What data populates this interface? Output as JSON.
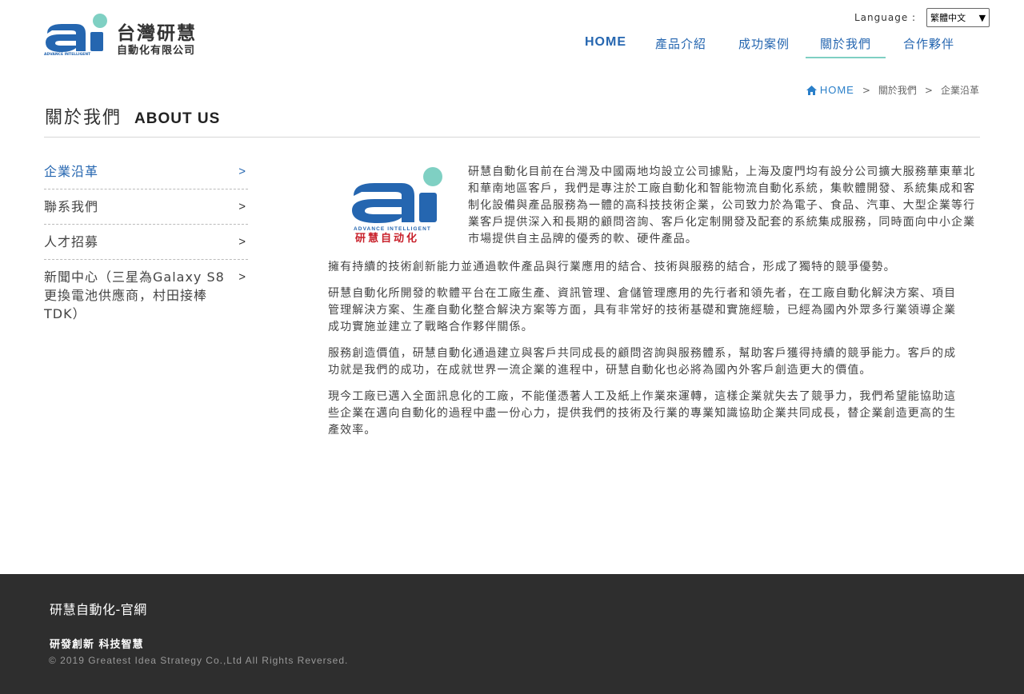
{
  "brand": {
    "logo_text": "ai",
    "logo_sub": "ADVANCE INTELLIGENT",
    "name_top": "台灣研慧",
    "name_bottom": "自動化有限公司",
    "colors": {
      "blue": "#2566b0",
      "teal": "#7fd0c3",
      "red": "#c8202a"
    }
  },
  "language": {
    "label": "Language :",
    "selected": "繁體中文",
    "arrow": "▼"
  },
  "nav": [
    {
      "label": "HOME",
      "active": false
    },
    {
      "label": "產品介紹",
      "active": false
    },
    {
      "label": "成功案例",
      "active": false
    },
    {
      "label": "關於我們",
      "active": true
    },
    {
      "label": "合作夥伴",
      "active": false
    }
  ],
  "breadcrumb": {
    "home": "HOME",
    "sep": ">",
    "level1": "關於我們",
    "level2": "企業沿革"
  },
  "page": {
    "title_cn": "關於我們",
    "title_en": "ABOUT US"
  },
  "sidebar": [
    {
      "label": "企業沿革",
      "active": true
    },
    {
      "label": "聯系我們",
      "active": false
    },
    {
      "label": "人才招募",
      "active": false
    },
    {
      "label": "新聞中心（三星為Galaxy S8更換電池供應商，村田接棒TDK）",
      "active": false
    }
  ],
  "sidebar_chevron": ">",
  "content": {
    "logo_text": "ai",
    "logo_sub_en": "ADVANCE INTELLIGENT",
    "logo_sub_cn": "研慧自动化",
    "intro": "研慧自動化目前在台灣及中國兩地均設立公司據點，上海及廈門均有設分公司擴大服務華東華北和華南地區客戶，我們是專注於工廠自動化和智能物流自動化系統，集軟體開發、系統集成和客制化設備與產品服務為一體的高科技技術企業，公司致力於為電子、食品、汽車、大型企業等行業客戶提供深入和長期的顧問咨詢、客戶化定制開發及配套的系統集成服務，同時面向中小企業市場提供自主品牌的優秀的軟、硬件產品。",
    "para1": "擁有持續的技術創新能力並通過軟件產品與行業應用的結合、技術與服務的結合，形成了獨特的競爭優勢。",
    "para2": "研慧自動化所開發的軟體平台在工廠生產、資訊管理、倉儲管理應用的先行者和領先者，在工廠自動化解決方案、項目管理解決方案、生產自動化整合解決方案等方面，具有非常好的技術基礎和實施經驗，已經為國內外眾多行業領導企業成功實施並建立了戰略合作夥伴關係。",
    "para3": "服務創造價值，研慧自動化通過建立與客戶共同成長的顧問咨詢與服務體系，幫助客戶獲得持續的競爭能力。客戶的成功就是我們的成功，在成就世界一流企業的進程中，研慧自動化也必將為國內外客戶創造更大的價值。",
    "para4": "現今工廠已邁入全面訊息化的工廠，不能僅憑著人工及紙上作業來運轉，這樣企業就失去了競爭力，我們希望能協助這些企業在邁向自動化的過程中盡一份心力，提供我們的技術及行業的專業知識協助企業共同成長，替企業創造更高的生產效率。"
  },
  "footer": {
    "site_name": "研慧自動化-官網",
    "slogan": "研發創新 科技智慧",
    "copyright": "© 2019 Greatest Idea Strategy Co.,Ltd All Rights Reversed."
  }
}
